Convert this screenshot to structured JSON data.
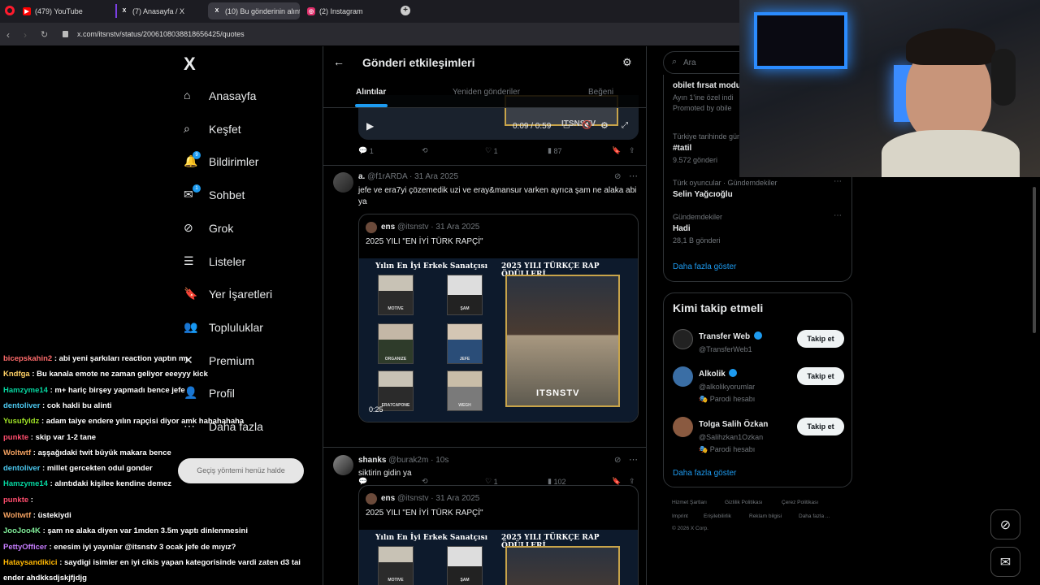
{
  "browser": {
    "tabs": [
      {
        "label": "(479) YouTube",
        "fav_color": "#ff0000",
        "fav_glyph": "▶"
      },
      {
        "label": "(7) Anasayfa / X",
        "fav_color": "#000000",
        "fav_glyph": "X"
      },
      {
        "label": "(10) Bu gönderinin alıntıla",
        "fav_color": "#000000",
        "fav_glyph": "X"
      },
      {
        "label": "(2) Instagram",
        "fav_color": "#e1306c",
        "fav_glyph": "◎"
      }
    ],
    "new_tab": "+",
    "url": "x.com/itsnstv/status/2006108038818656425/quotes"
  },
  "left_nav": {
    "logo": "X",
    "items": [
      {
        "label": "Anasayfa",
        "icon": "home-icon"
      },
      {
        "label": "Keşfet",
        "icon": "search-icon"
      },
      {
        "label": "Bildirimler",
        "icon": "bell-icon",
        "badge": "9"
      },
      {
        "label": "Sohbet",
        "icon": "mail-icon",
        "badge": "1"
      },
      {
        "label": "Grok",
        "icon": "grok-icon"
      },
      {
        "label": "Listeler",
        "icon": "list-icon"
      },
      {
        "label": "Yer İşaretleri",
        "icon": "bookmark-icon"
      },
      {
        "label": "Topluluklar",
        "icon": "people-icon"
      },
      {
        "label": "Premium",
        "icon": "x-icon"
      },
      {
        "label": "Profil",
        "icon": "person-icon"
      },
      {
        "label": "Daha fazla",
        "icon": "more-icon"
      }
    ]
  },
  "header": {
    "title": "Gönderi etkileşimleri",
    "tabs": [
      "Alıntılar",
      "Yeniden gönderiler",
      "Beğeni"
    ]
  },
  "video_top": {
    "time": "0:09 / 0:59",
    "watermark": "ITSNSTV",
    "replies": "1",
    "likes": "1",
    "views": "87"
  },
  "post1": {
    "name": "a.",
    "handle": "@f1rARDA",
    "date": "· 31 Ara 2025",
    "text": "jefe ve era7yi çözemedik uzi ve eray&mansur varken ayrıca şam ne alaka abi ya",
    "quote": {
      "name": "ens",
      "handle": "@itsnstv",
      "date": "· 31 Ara 2025",
      "text": "2025 YILI \"EN İYİ TÜRK RAPÇİ\""
    },
    "thumb": {
      "left_title": "Yılın En İyi Erkek Sanatçısı",
      "right_title": "2025 YILI TÜRKÇE RAP ÖDÜLLERİ",
      "cells": [
        "MOTIVE",
        "ŞAM",
        "ORGANIZE",
        "JEFE",
        "ERA7CAPONE",
        "WEGH"
      ],
      "watermark": "ITSNSTV",
      "duration": "0:25"
    },
    "replies": "",
    "likes": "1",
    "views": "102"
  },
  "post2": {
    "name": "shanks",
    "handle": "@burak2m",
    "date": "· 10s",
    "text": "siktirin gidin ya",
    "quote": {
      "name": "ens",
      "handle": "@itsnstv",
      "date": "· 31 Ara 2025",
      "text": "2025 YILI \"EN İYİ TÜRK RAPÇİ\""
    },
    "thumb": {
      "left_title": "Yılın En İyi Erkek Sanatçısı",
      "right_title": "2025 YILI TÜRKÇE RAP ÖDÜLLERİ",
      "cells": [
        "MOTIVE",
        "ŞAM"
      ]
    }
  },
  "right": {
    "search_placeholder": "Ara",
    "trends": [
      {
        "meta": "",
        "title": "obilet fırsat modu",
        "sub": "Ayın 1'ine özel indi",
        "sub2": "Promoted by obile"
      },
      {
        "meta": "Türkiye tarihinde gün",
        "title": "#tatil",
        "sub": "9.572 gönderi"
      },
      {
        "meta": "Türk oyuncular · Gündemdekiler",
        "title": "Selin Yağcıoğlu",
        "sub": ""
      },
      {
        "meta": "Gündemdekiler",
        "title": "Hadi",
        "sub": "28,1 B gönderi"
      }
    ],
    "show_more": "Daha fazla göster",
    "who_title": "Kimi takip etmeli",
    "who": [
      {
        "name": "Transfer Web",
        "handle": "@TransferWeb1",
        "note": "",
        "btn": "Takip et",
        "color": "#333"
      },
      {
        "name": "Alkolik",
        "handle": "@alkolikyorumlar",
        "note": "Parodi hesabı",
        "btn": "Takip et",
        "color": "#3a6ea5"
      },
      {
        "name": "Tolga Salih Özkan",
        "handle": "@Salihzkan1Ozkan",
        "note": "Parodi hesabı",
        "btn": "Takip et",
        "color": "#8a5a40"
      }
    ],
    "who_more": "Daha fazla göster",
    "footer": [
      "Hizmet Şartları",
      "Gizlilik Politikası",
      "Çerez Politikası",
      "Imprint",
      "Erişilebilirlik",
      "Reklam bilgisi",
      "Daha fazla ...",
      "© 2026 X Corp."
    ]
  },
  "chat": [
    {
      "user": "bicepskahin2",
      "color": "#ff6b6b",
      "text": ": abi yeni şarkıları reaction yaptın mı"
    },
    {
      "user": "Kndfga",
      "color": "#ffd166",
      "text": ": Bu kanala emote ne zaman geliyor eeeyyy kick"
    },
    {
      "user": "Hamzyme14",
      "color": "#06d6a0",
      "text": ": m+ hariç birşey yapmadı bence jefe"
    },
    {
      "user": "dentoliver",
      "color": "#4cc9f0",
      "text": ": cok hakli bu alinti"
    },
    {
      "user": "Yusufyldz",
      "color": "#a0e426",
      "text": ": adam taiye endere yılın rapçisi diyor amk hahahahaha"
    },
    {
      "user": "punkte",
      "color": "#ff4d6d",
      "text": ": skip var 1-2 tane"
    },
    {
      "user": "Woltwtf",
      "color": "#f4a261",
      "text": ": aşşağıdaki twit büyük makara bence"
    },
    {
      "user": "dentoliver",
      "color": "#4cc9f0",
      "text": ": millet gercekten odul gonder"
    },
    {
      "user": "Hamzyme14",
      "color": "#06d6a0",
      "text": ": alıntıdaki kişilee kendine demez"
    },
    {
      "user": "punkte",
      "color": "#ff4d6d",
      "text": ":"
    },
    {
      "user": "Woltwtf",
      "color": "#f4a261",
      "text": ": üstekiydi"
    },
    {
      "user": "JooJoo4K",
      "color": "#80ed99",
      "text": ": şam ne alaka diyen var 1mden 3.5m yaptı dinlenmesini"
    },
    {
      "user": "PettyOfficer",
      "color": "#c77dff",
      "text": ": enesim iyi yayınlar @itsnstv 3 ocak jefe de mıyız?"
    },
    {
      "user": "Hataysandikici",
      "color": "#ffb703",
      "text": ": saydigi isimler en iyi cikis yapan kategorisinde vardi zaten d3 tai"
    },
    {
      "user": "",
      "color": "#ffffff",
      "text": "ender ahdkksdjskjfjdjg"
    }
  ],
  "toast": "Geçiş yöntemi henüz halde"
}
